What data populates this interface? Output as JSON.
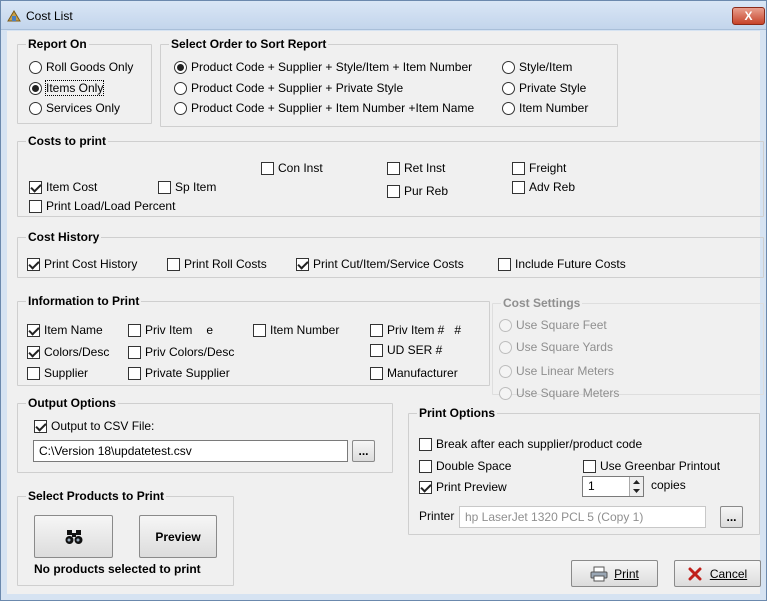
{
  "window": {
    "title": "Cost List",
    "close_label": "X"
  },
  "report_on": {
    "title": "Report On",
    "options": [
      "Roll Goods Only",
      "Items Only",
      "Services Only"
    ]
  },
  "sort_order": {
    "title": "Select Order to Sort Report",
    "options": [
      "Product Code + Supplier + Style/Item + Item Number",
      "Product Code + Supplier + Private Style",
      "Product Code + Supplier + Item Number +Item Name",
      "Style/Item",
      "Private Style",
      "Item Number"
    ]
  },
  "costs_to_print": {
    "title": "Costs to print",
    "con_inst": "Con Inst",
    "ret_inst": "Ret Inst",
    "freight": "Freight",
    "item_cost": "Item Cost",
    "sp_item": "Sp Item",
    "pur_reb": "Pur Reb",
    "adv_reb": "Adv Reb",
    "load_percent": "Print Load/Load Percent"
  },
  "cost_history": {
    "title": "Cost History",
    "print_cost_history": "Print Cost History",
    "print_roll_costs": "Print Roll Costs",
    "print_cut_costs": "Print Cut/Item/Service Costs",
    "include_future": "Include Future Costs"
  },
  "info_to_print": {
    "title": "Information to Print",
    "item_name": "Item Name",
    "priv_item": "Priv Item",
    "priv_item_suffix": "e",
    "item_number": "Item Number",
    "priv_item_num": "Priv Item #",
    "priv_item_num_suffix": "#",
    "colors_desc": "Colors/Desc",
    "priv_colors_desc": "Priv Colors/Desc",
    "ud_ser": "UD SER #",
    "supplier": "Supplier",
    "private_supplier": "Private Supplier",
    "manufacturer": "Manufacturer"
  },
  "cost_settings": {
    "title": "Cost Settings",
    "options": [
      "Use Square Feet",
      "Use Square Yards",
      "Use Linear Meters",
      "Use Square Meters"
    ]
  },
  "output_options": {
    "title": "Output Options",
    "csv_label": "Output to CSV File:",
    "csv_path": "C:\\Version 18\\updatetest.csv",
    "browse_label": "..."
  },
  "print_options": {
    "title": "Print  Options",
    "break_after": "Break after each supplier/product code",
    "double_space": "Double Space",
    "greenbar": "Use Greenbar Printout",
    "print_preview": "Print Preview",
    "copies_value": "1",
    "copies_label": "copies",
    "printer_label": "Printer",
    "printer_value": "hp LaserJet 1320 PCL 5 (Copy 1)",
    "printer_browse": "..."
  },
  "select_products": {
    "title": "Select Products to Print",
    "preview_label": "Preview",
    "status": "No products selected to print"
  },
  "footer": {
    "print_label": "Print",
    "cancel_label": "Cancel"
  },
  "colors": {
    "title_bar": "#c3d5ec",
    "close": "#c7432a",
    "dialog": "#f0f0f0"
  }
}
